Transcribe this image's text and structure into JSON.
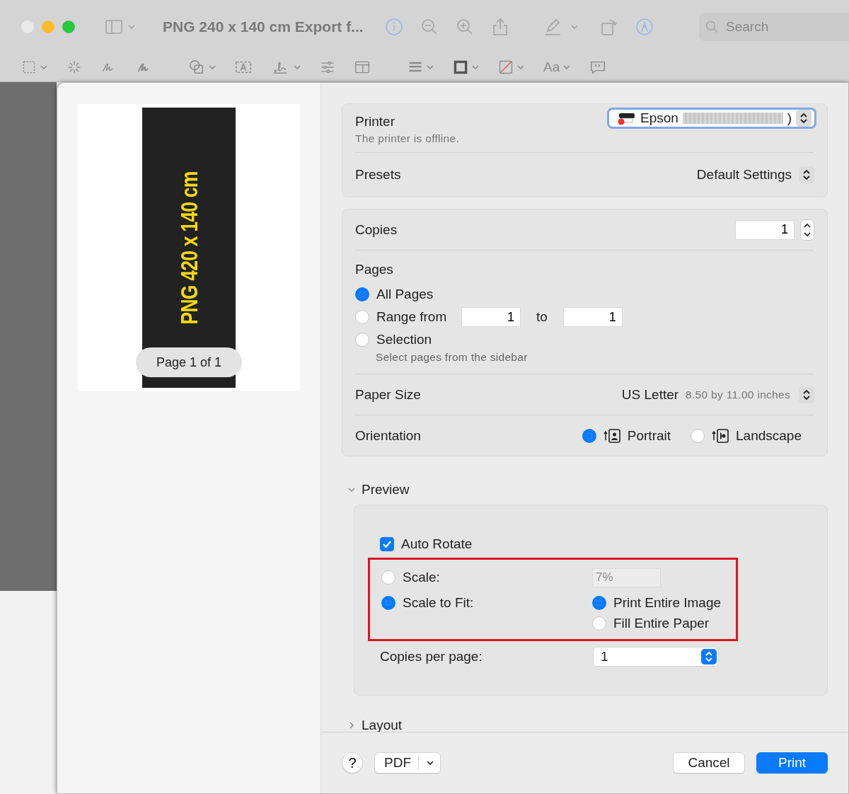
{
  "window": {
    "title": "PNG 240 x 140 cm Export f...",
    "search": {
      "placeholder": "Search"
    },
    "font_button": "Aa"
  },
  "preview": {
    "poster_text": "PNG 420 x 140 cm",
    "page_label": "Page 1 of 1"
  },
  "printer": {
    "label": "Printer",
    "value": "Epson",
    "value_end": ")",
    "status": "The printer is offline.",
    "offline": true
  },
  "presets": {
    "label": "Presets",
    "value": "Default Settings"
  },
  "copies": {
    "label": "Copies",
    "value": "1"
  },
  "pages": {
    "label": "Pages",
    "options": [
      {
        "kind": "plain",
        "label": "All Pages",
        "selected": true
      },
      {
        "kind": "range",
        "label": "Range from",
        "selected": false,
        "from": "1",
        "to_label": "to",
        "to": "1"
      },
      {
        "kind": "hint",
        "label": "Selection",
        "selected": false,
        "hint": "Select pages from the sidebar"
      }
    ]
  },
  "paper_size": {
    "label": "Paper Size",
    "value": "US Letter",
    "detail": "8.50 by 11.00 inches"
  },
  "orientation": {
    "label": "Orientation",
    "options": [
      {
        "kind": "portrait",
        "label": "Portrait",
        "selected": true
      },
      {
        "kind": "landscape",
        "label": "Landscape",
        "selected": false
      }
    ]
  },
  "preview_section": {
    "title": "Preview",
    "expanded": true,
    "auto_rotate": {
      "label": "Auto Rotate",
      "checked": true
    },
    "scale": {
      "highlighted": true,
      "options": [
        {
          "label": "Scale:",
          "selected": false,
          "value": "7%"
        },
        {
          "label": "Scale to Fit:",
          "selected": true
        }
      ],
      "fit_options": [
        {
          "label": "Print Entire Image",
          "selected": true
        },
        {
          "label": "Fill Entire Paper",
          "selected": false
        }
      ]
    },
    "copies_per_page": {
      "label": "Copies per page:",
      "value": "1"
    }
  },
  "layout_section": {
    "title": "Layout",
    "expanded": false
  },
  "footer": {
    "help": "?",
    "pdf": "PDF",
    "cancel": "Cancel",
    "print": "Print"
  }
}
